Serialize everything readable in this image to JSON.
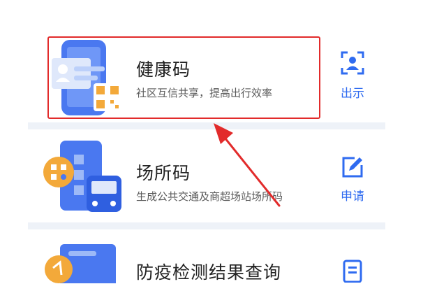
{
  "services": [
    {
      "title": "健康码",
      "subtitle": "社区互信共享，提高出行效率",
      "action_label": "出示",
      "illustration_icon": "health-code-phone-icon",
      "action_icon": "scan-person-icon"
    },
    {
      "title": "场所码",
      "subtitle": "生成公共交通及商超场站场所码",
      "action_label": "申请",
      "illustration_icon": "venue-code-bus-icon",
      "action_icon": "edit-icon"
    },
    {
      "title": "防疫检测结果查询",
      "subtitle": "",
      "action_label": "",
      "illustration_icon": "test-result-document-icon",
      "action_icon": "document-icon"
    }
  ],
  "colors": {
    "accent": "#2f6bf0",
    "highlight": "#e22b2b",
    "divider": "#eef2f8"
  }
}
